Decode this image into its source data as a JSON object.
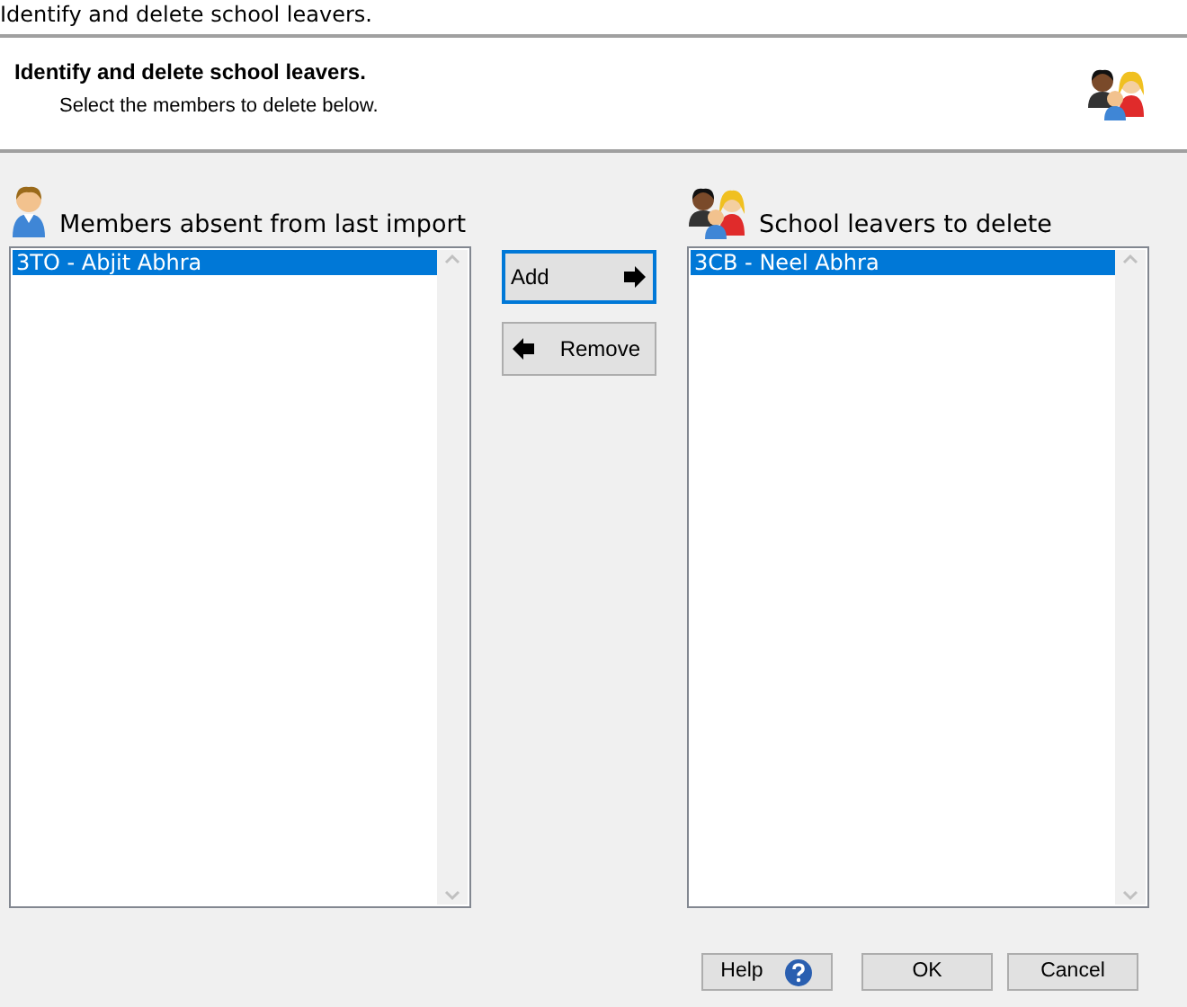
{
  "window": {
    "title": "Identify and delete school leavers."
  },
  "header": {
    "title": "Identify and delete school leavers.",
    "subtitle": "Select the members to delete below."
  },
  "lists": [
    {
      "title": "Members absent from last import",
      "kind": "single",
      "items": [
        {
          "label": "3TO - Abjit Abhra",
          "selected": true
        }
      ]
    },
    {
      "title": "School leavers to delete",
      "kind": "group",
      "items": [
        {
          "label": "3CB - Neel Abhra",
          "selected": true
        }
      ]
    }
  ],
  "transfer_buttons": [
    {
      "label": "Add",
      "kind": "add",
      "focused": true
    },
    {
      "label": "Remove",
      "kind": "remove",
      "focused": false
    }
  ],
  "footer_buttons": [
    {
      "label": "Help",
      "kind": "help"
    },
    {
      "label": "OK",
      "kind": "plain"
    },
    {
      "label": "Cancel",
      "kind": "plain"
    }
  ]
}
